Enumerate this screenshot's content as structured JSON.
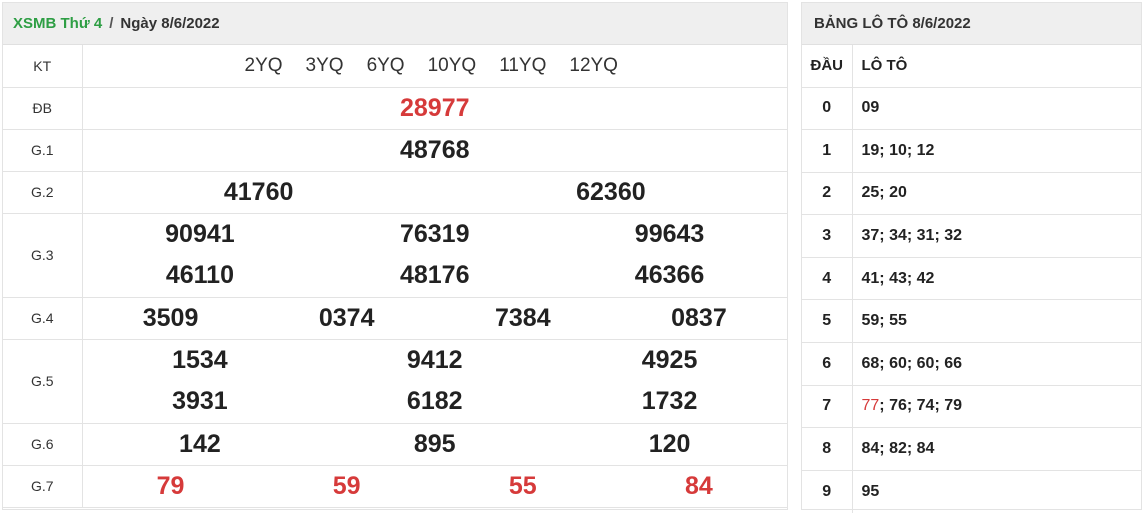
{
  "header": {
    "brand": "XSMB Thứ 4",
    "separator": "/",
    "date": "Ngày 8/6/2022"
  },
  "results": {
    "kt_label": "KT",
    "codes": [
      "2YQ",
      "3YQ",
      "6YQ",
      "10YQ",
      "11YQ",
      "12YQ"
    ],
    "prizes": [
      {
        "label": "ĐB",
        "rows": [
          [
            "28977"
          ]
        ],
        "highlight": true
      },
      {
        "label": "G.1",
        "rows": [
          [
            "48768"
          ]
        ]
      },
      {
        "label": "G.2",
        "rows": [
          [
            "41760",
            "62360"
          ]
        ]
      },
      {
        "label": "G.3",
        "rows": [
          [
            "90941",
            "76319",
            "99643"
          ],
          [
            "46110",
            "48176",
            "46366"
          ]
        ]
      },
      {
        "label": "G.4",
        "rows": [
          [
            "3509",
            "0374",
            "7384",
            "0837"
          ]
        ]
      },
      {
        "label": "G.5",
        "rows": [
          [
            "1534",
            "9412",
            "4925"
          ],
          [
            "3931",
            "6182",
            "1732"
          ]
        ]
      },
      {
        "label": "G.6",
        "rows": [
          [
            "142",
            "895",
            "120"
          ]
        ]
      },
      {
        "label": "G.7",
        "rows": [
          [
            "79",
            "59",
            "55",
            "84"
          ]
        ],
        "highlight": true
      }
    ]
  },
  "loto": {
    "title": "BẢNG LÔ TÔ 8/6/2022",
    "col_dau": "ĐẦU",
    "col_loto": "LÔ TÔ",
    "rows": [
      {
        "dau": "0",
        "values": [
          "09"
        ]
      },
      {
        "dau": "1",
        "values": [
          "19",
          "10",
          "12"
        ]
      },
      {
        "dau": "2",
        "values": [
          "25",
          "20"
        ]
      },
      {
        "dau": "3",
        "values": [
          "37",
          "34",
          "31",
          "32"
        ]
      },
      {
        "dau": "4",
        "values": [
          "41",
          "43",
          "42"
        ]
      },
      {
        "dau": "5",
        "values": [
          "59",
          "55"
        ]
      },
      {
        "dau": "6",
        "values": [
          "68",
          "60",
          "60",
          "66"
        ]
      },
      {
        "dau": "7",
        "values": [
          "77",
          "76",
          "74",
          "79"
        ],
        "first_highlight": true
      },
      {
        "dau": "8",
        "values": [
          "84",
          "82",
          "84"
        ]
      },
      {
        "dau": "9",
        "values": [
          "95"
        ]
      }
    ]
  },
  "colors": {
    "green": "#2e9e44",
    "red": "#d63a3a"
  }
}
